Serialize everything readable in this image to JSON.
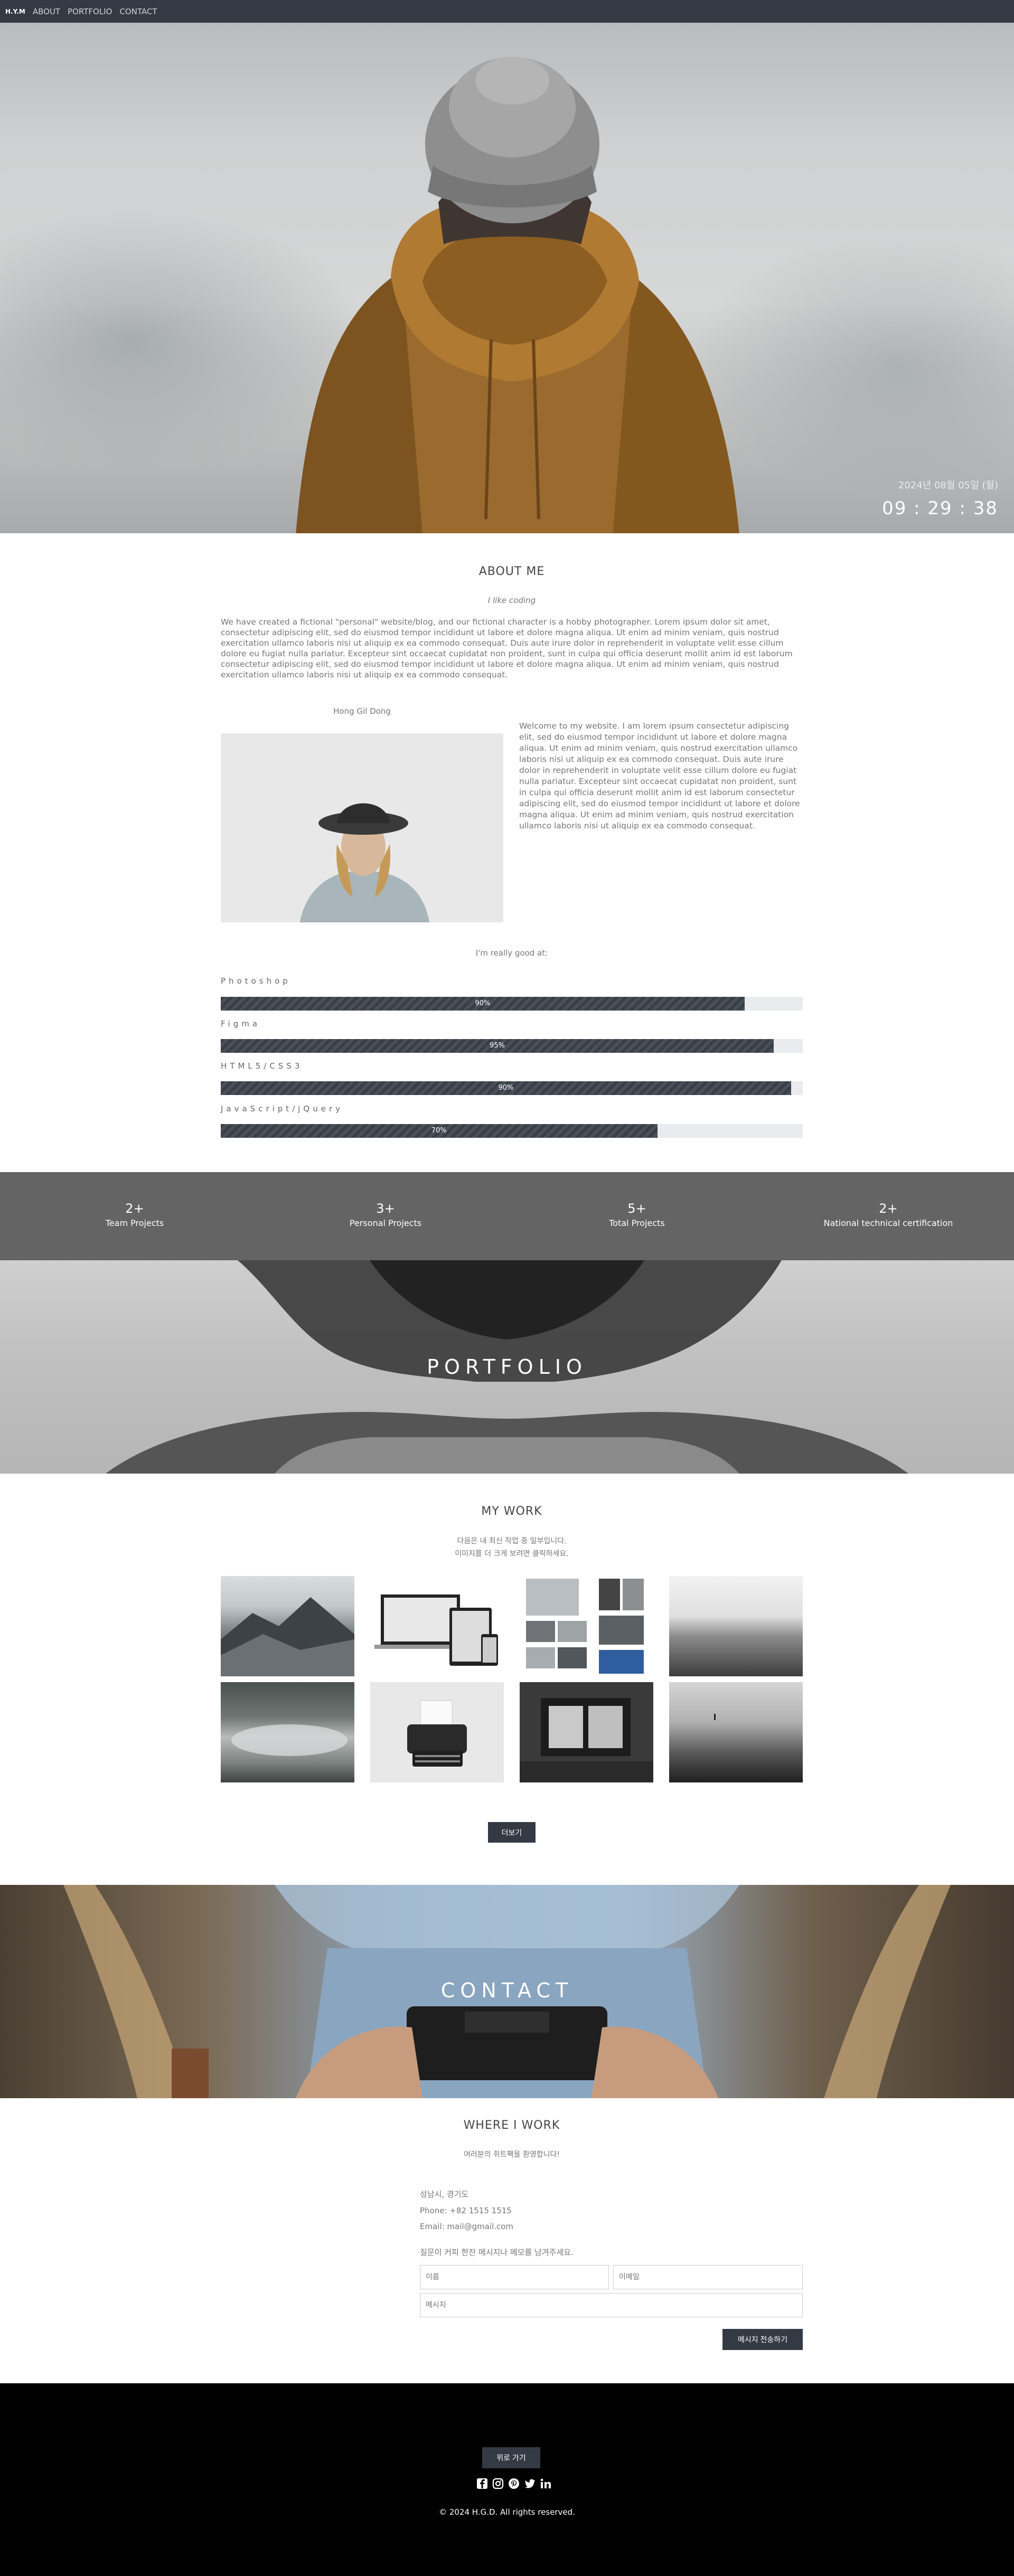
{
  "nav": {
    "brand": "H.Y.M",
    "links": [
      "ABOUT",
      "PORTFOLIO",
      "CONTACT"
    ]
  },
  "hero": {
    "date": "2024년 08월 05일 (월)",
    "time": "09 : 29 : 38"
  },
  "about": {
    "title": "ABOUT ME",
    "subtitle": "I like coding",
    "intro": "We have created a fictional \"personal\" website/blog, and our fictional character is a hobby photographer. Lorem ipsum dolor sit amet, consectetur adipiscing elit, sed do eiusmod tempor incididunt ut labore et dolore magna aliqua. Ut enim ad minim veniam, quis nostrud exercitation ullamco laboris nisi ut aliquip ex ea commodo consequat. Duis aute irure dolor in reprehenderit in voluptate velit esse cillum dolore eu fugiat nulla pariatur. Excepteur sint occaecat cupidatat non proident, sunt in culpa qui officia deserunt mollit anim id est laborum consectetur adipiscing elit, sed do eiusmod tempor incididunt ut labore et dolore magna aliqua. Ut enim ad minim veniam, quis nostrud exercitation ullamco laboris nisi ut aliquip ex ea commodo consequat.",
    "name": "Hong Gil Dong",
    "bio": "Welcome to my website. I am lorem ipsum consectetur adipiscing elit, sed do eiusmod tempor incididunt ut labore et dolore magna aliqua. Ut enim ad minim veniam, quis nostrud exercitation ullamco laboris nisi ut aliquip ex ea commodo consequat. Duis aute irure dolor in reprehenderit in voluptate velit esse cillum dolore eu fugiat nulla pariatur. Excepteur sint occaecat cupidatat non proident, sunt in culpa qui officia deserunt mollit anim id est laborum consectetur adipiscing elit, sed do eiusmod tempor incididunt ut labore et dolore magna aliqua. Ut enim ad minim veniam, quis nostrud exercitation ullamco laboris nisi ut aliquip ex ea commodo consequat.",
    "skills_title": "I'm really good at:",
    "skills": [
      {
        "name": "Photoshop",
        "label": "90%",
        "level": 0.9
      },
      {
        "name": "Figma",
        "label": "95%",
        "level": 0.95
      },
      {
        "name": "HTML5/CSS3",
        "label": "90%",
        "level": 0.98
      },
      {
        "name": "JavaScript/jQuery",
        "label": "70%",
        "level": 0.75
      }
    ]
  },
  "stats": [
    {
      "num": "2+",
      "label": "Team Projects"
    },
    {
      "num": "3+",
      "label": "Personal Projects"
    },
    {
      "num": "5+",
      "label": "Total Projects"
    },
    {
      "num": "2+",
      "label": "National technical certification"
    }
  ],
  "portfolio": {
    "banner": "PORTFOLIO",
    "title": "MY WORK",
    "desc1": "다음은 내 최신 작업 중 일부입니다.",
    "desc2": "이미지를 더 크게 보려면 클릭하세요.",
    "more_label": "더보기"
  },
  "contact": {
    "banner": "CONTACT",
    "title": "WHERE I WORK",
    "subtitle": "여러분의 취트팩을 환영합니다!",
    "city": "성남시, 경기도",
    "phone": "Phone: +82 1515 1515",
    "email": "Email: mail@gmail.com",
    "prompt": "질문이 커피 한잔 메시지나 메모를 남겨주세요.",
    "name_placeholder": "이름",
    "email_placeholder": "이메일",
    "message_placeholder": "메시지",
    "send_label": "메시지 전송하기"
  },
  "footer": {
    "top_label": "위로 가기",
    "copyright": "© 2024 H.G.D. All rights reserved."
  }
}
